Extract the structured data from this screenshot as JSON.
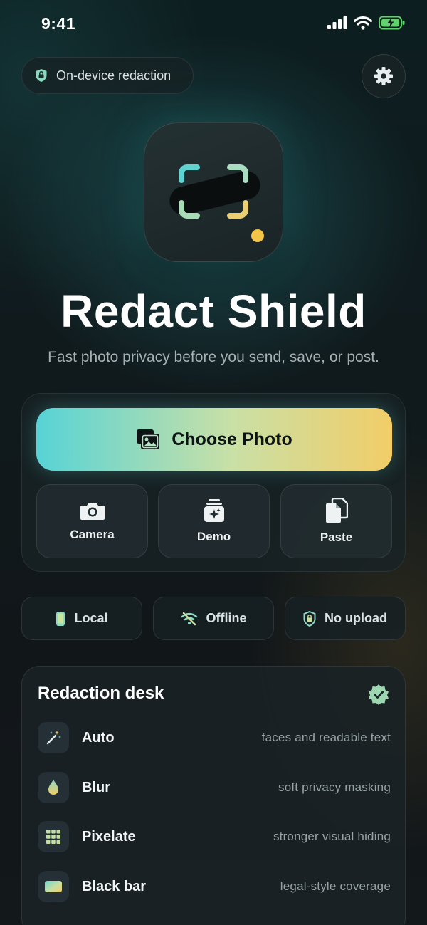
{
  "status": {
    "time": "9:41"
  },
  "header": {
    "pill_label": "On-device redaction"
  },
  "hero": {
    "title": "Redact Shield",
    "subtitle": "Fast photo privacy before you send, save, or post."
  },
  "actions": {
    "primary_label": "Choose Photo",
    "tiles": [
      {
        "label": "Camera",
        "icon": "camera-icon"
      },
      {
        "label": "Demo",
        "icon": "demo-stack-icon"
      },
      {
        "label": "Paste",
        "icon": "paste-icon"
      }
    ]
  },
  "chips": [
    {
      "label": "Local",
      "icon": "phone-icon"
    },
    {
      "label": "Offline",
      "icon": "wifi-off-icon"
    },
    {
      "label": "No upload",
      "icon": "lock-shield-icon"
    }
  ],
  "desk": {
    "title": "Redaction desk",
    "rows": [
      {
        "label": "Auto",
        "desc": "faces and readable text",
        "icon": "magic-wand-icon"
      },
      {
        "label": "Blur",
        "desc": "soft privacy masking",
        "icon": "droplet-icon"
      },
      {
        "label": "Pixelate",
        "desc": "stronger visual hiding",
        "icon": "grid-icon"
      },
      {
        "label": "Black bar",
        "desc": "legal-style coverage",
        "icon": "gradient-bar-icon"
      }
    ]
  },
  "colors": {
    "accent_teal": "#57d3d6",
    "accent_yellow": "#f2cd68",
    "background": "#101a1d"
  }
}
